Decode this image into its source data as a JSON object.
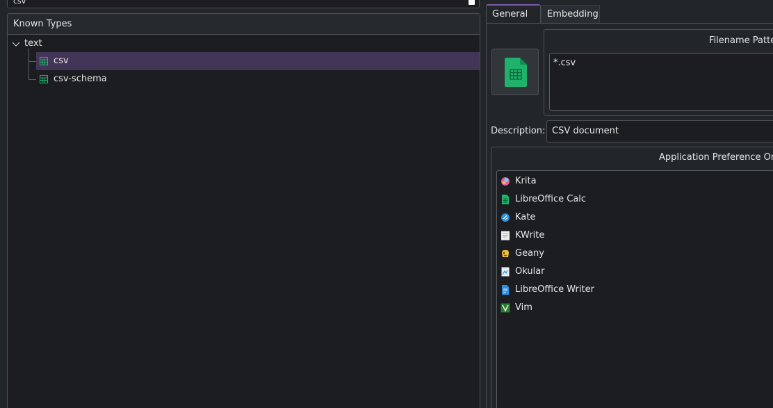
{
  "search": {
    "query": "csv"
  },
  "tree": {
    "header": "Known Types",
    "folder": "text",
    "items": [
      {
        "label": "csv",
        "selected": true
      },
      {
        "label": "csv-schema",
        "selected": false
      }
    ]
  },
  "tabs": {
    "general": "General",
    "embedding": "Embedding"
  },
  "general": {
    "filename_patterns_title": "Filename Patter",
    "patterns": [
      "*.csv"
    ],
    "description_label": "Description:",
    "description_value": "CSV document",
    "app_pref_title": "Application Preference Ord",
    "apps": [
      {
        "label": "Krita",
        "icon": "krita-icon"
      },
      {
        "label": "LibreOffice Calc",
        "icon": "libreoffice-calc-icon"
      },
      {
        "label": "Kate",
        "icon": "kate-icon"
      },
      {
        "label": "KWrite",
        "icon": "kwrite-icon"
      },
      {
        "label": "Geany",
        "icon": "geany-icon"
      },
      {
        "label": "Okular",
        "icon": "okular-icon"
      },
      {
        "label": "LibreOffice Writer",
        "icon": "libreoffice-writer-icon"
      },
      {
        "label": "Vim",
        "icon": "vim-icon"
      }
    ]
  },
  "colors": {
    "selection": "#433558",
    "tab_accent": "#7a59a3",
    "spreadsheet_green": "#1fb26b"
  }
}
